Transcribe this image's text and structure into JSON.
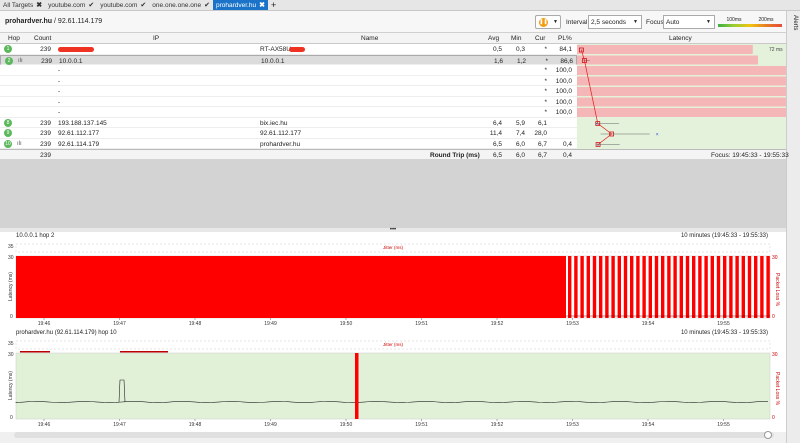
{
  "tabs": [
    {
      "label": "All Targets",
      "mark": "✖",
      "active": false
    },
    {
      "label": "youtube.com",
      "mark": "✔",
      "active": false
    },
    {
      "label": "youtube.com",
      "mark": "✔",
      "active": false
    },
    {
      "label": "one.one.one.one",
      "mark": "✔",
      "active": false
    },
    {
      "label": "prohardver.hu",
      "mark": "✖",
      "active": true
    }
  ],
  "header": {
    "target_name": "prohardver.hu",
    "target_ip": "/ 92.61.114.179",
    "interval_label": "Interval",
    "interval_value": "2,5 seconds",
    "focus_label": "Focus",
    "focus_value": "Auto",
    "scale_low": "100ms",
    "scale_high": "200ms",
    "alerts_label": "Alerts"
  },
  "table": {
    "columns": {
      "hop": "Hop",
      "count": "Count",
      "ip": "IP",
      "name": "Name",
      "avg": "Avg",
      "min": "Min",
      "cur": "Cur",
      "pl": "PL%",
      "latency": "Latency"
    },
    "lat_min": "0 ms",
    "lat_max": "72 ms",
    "rows": [
      {
        "hop": "1",
        "count": "239",
        "ip": "",
        "name": "RT-AX58U",
        "avg": "0,5",
        "min": "0,3",
        "cur": "*",
        "pl": "84,1"
      },
      {
        "hop": "2",
        "count": "239",
        "ip": "10.0.0.1",
        "name": "10.0.0.1",
        "avg": "1,6",
        "min": "1,2",
        "cur": "*",
        "pl": "86,6"
      },
      {
        "hop": "",
        "count": "",
        "ip": "-",
        "name": "",
        "avg": "",
        "min": "",
        "cur": "*",
        "pl": "100,0"
      },
      {
        "hop": "",
        "count": "",
        "ip": "-",
        "name": "",
        "avg": "",
        "min": "",
        "cur": "*",
        "pl": "100,0"
      },
      {
        "hop": "",
        "count": "",
        "ip": "-",
        "name": "",
        "avg": "",
        "min": "",
        "cur": "*",
        "pl": "100,0"
      },
      {
        "hop": "",
        "count": "",
        "ip": "-",
        "name": "",
        "avg": "",
        "min": "",
        "cur": "*",
        "pl": "100,0"
      },
      {
        "hop": "",
        "count": "",
        "ip": "-",
        "name": "",
        "avg": "",
        "min": "",
        "cur": "*",
        "pl": "100,0"
      },
      {
        "hop": "8",
        "count": "239",
        "ip": "193.188.137.145",
        "name": "bix.iec.hu",
        "avg": "6,4",
        "min": "5,9",
        "cur": "6,1",
        "pl": ""
      },
      {
        "hop": "9",
        "count": "239",
        "ip": "92.61.112.177",
        "name": "92.61.112.177",
        "avg": "11,4",
        "min": "7,4",
        "cur": "28,0",
        "pl": ""
      },
      {
        "hop": "10",
        "count": "239",
        "ip": "92.61.114.179",
        "name": "prohardver.hu",
        "avg": "6,5",
        "min": "6,0",
        "cur": "6,7",
        "pl": "0,4"
      }
    ],
    "footer": {
      "count": "239",
      "label": "Round Trip (ms)",
      "avg": "6,5",
      "min": "6,0",
      "cur": "6,7",
      "pl": "0,4",
      "focus": "Focus: 19:45:33 - 19:55:33"
    }
  },
  "chart1": {
    "title": "10.0.0.1 hop 2",
    "range": "10 minutes (19:45:33 - 19:55:33)",
    "jitter_label": "Jitter (ms)",
    "ylabel": "Latency (ms)",
    "y2label": "Packet Loss %",
    "y_top": "35",
    "y_mid": "30",
    "y_zero": "0",
    "y2_top": "30",
    "y2_zero": "0",
    "time_ticks": [
      "19:46",
      "19:47",
      "19:48",
      "19:49",
      "19:50",
      "19:51",
      "19:52",
      "19:53",
      "19:54",
      "19:55"
    ]
  },
  "chart2": {
    "title": "prohardver.hu (92.61.114.179) hop 10",
    "range": "10 minutes (19:45:33 - 19:55:33)",
    "jitter_label": "Jitter (ms)",
    "ylabel": "Latency (ms)",
    "y2label": "Packet Loss %",
    "y_top": "35",
    "y_mid": "30",
    "y_zero": "0",
    "y2_top": "30",
    "y2_zero": "0",
    "time_ticks": [
      "19:46",
      "19:47",
      "19:48",
      "19:49",
      "19:50",
      "19:51",
      "19:52",
      "19:53",
      "19:54",
      "19:55"
    ]
  }
}
